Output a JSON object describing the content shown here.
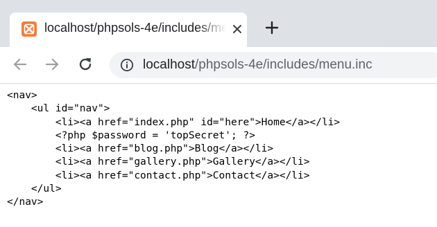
{
  "tab": {
    "title": "localhost/phpsols-4e/includes/menu.inc",
    "favicon": "xampp-icon",
    "close_icon": "close-icon",
    "new_tab_icon": "plus-icon"
  },
  "toolbar": {
    "back_icon": "arrow-left-icon",
    "forward_icon": "arrow-right-icon",
    "reload_icon": "reload-icon",
    "info_icon": "info-icon"
  },
  "address": {
    "host": "localhost",
    "path": "/phpsols-4e/includes/menu.inc"
  },
  "code": {
    "lines": [
      "<nav>",
      "    <ul id=\"nav\">",
      "        <li><a href=\"index.php\" id=\"here\">Home</a></li>",
      "        <?php $password = 'topSecret'; ?>",
      "        <li><a href=\"blog.php\">Blog</a></li>",
      "        <li><a href=\"gallery.php\">Gallery</a></li>",
      "        <li><a href=\"contact.php\">Contact</a></li>",
      "    </ul>",
      "</nav>"
    ]
  },
  "colors": {
    "tabstrip": "#dee1e6",
    "omnibox": "#f1f3f4",
    "favicon": "#f57c3a",
    "url_path": "#5f6368"
  }
}
